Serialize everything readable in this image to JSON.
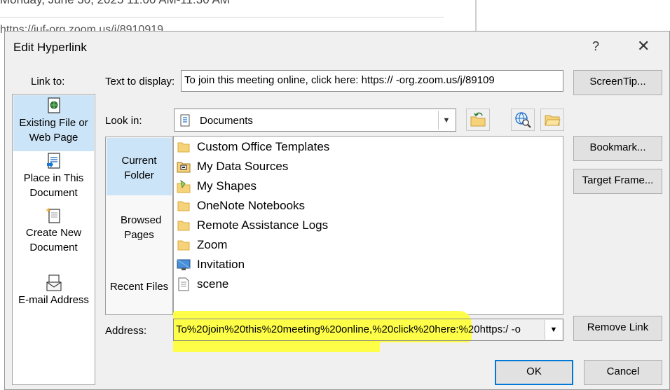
{
  "background": {
    "line1": "Monday, June 30, 2025 11:00 AM-11:30 AM",
    "line2": "https://iuf-org.zoom.us/j/8910919",
    "edge_chars": [
      "ov",
      "",
      "M",
      "",
      "",
      "",
      "",
      "",
      "s",
      "2",
      "n",
      "",
      "",
      "F",
      "5",
      "u",
      "3"
    ]
  },
  "dialog": {
    "title": "Edit Hyperlink",
    "help_label": "?",
    "close_label": "✕",
    "link_to_label": "Link to:",
    "text_to_display_label": "Text to display:",
    "text_to_display_value": "To join this meeting online, click here: https://      -org.zoom.us/j/89109",
    "look_in_label": "Look in:",
    "look_in_value": "Documents",
    "address_label": "Address:",
    "address_value": "To%20join%20this%20meeting%20online,%20click%20here:%20https:/     -o",
    "link_to_items": [
      {
        "label": "Existing File or Web Page",
        "icon": "web-page-icon",
        "selected": true
      },
      {
        "label": "Place in This Document",
        "icon": "document-place-icon",
        "selected": false
      },
      {
        "label": "Create New Document",
        "icon": "new-document-icon",
        "selected": false
      },
      {
        "label": "E-mail Address",
        "icon": "email-icon",
        "selected": false
      }
    ],
    "nav_items": [
      {
        "label": "Current Folder",
        "selected": true
      },
      {
        "label": "Browsed Pages",
        "selected": false
      },
      {
        "label": "Recent Files",
        "selected": false
      }
    ],
    "files": [
      {
        "name": "Custom Office Templates",
        "icon": "folder-icon"
      },
      {
        "name": "My Data Sources",
        "icon": "data-source-folder-icon"
      },
      {
        "name": "My Shapes",
        "icon": "shapes-folder-icon"
      },
      {
        "name": "OneNote Notebooks",
        "icon": "folder-icon"
      },
      {
        "name": "Remote Assistance Logs",
        "icon": "folder-icon"
      },
      {
        "name": "Zoom",
        "icon": "folder-icon"
      },
      {
        "name": "Invitation",
        "icon": "monitor-icon"
      },
      {
        "name": "scene",
        "icon": "text-file-icon"
      }
    ],
    "buttons": {
      "screentip": "ScreenTip...",
      "bookmark": "Bookmark...",
      "target_frame": "Target Frame...",
      "remove_link": "Remove Link",
      "ok": "OK",
      "cancel": "Cancel"
    },
    "colors": {
      "selection": "#cce4f7",
      "highlight": "#ffff3a",
      "accent": "#0078d7"
    }
  }
}
